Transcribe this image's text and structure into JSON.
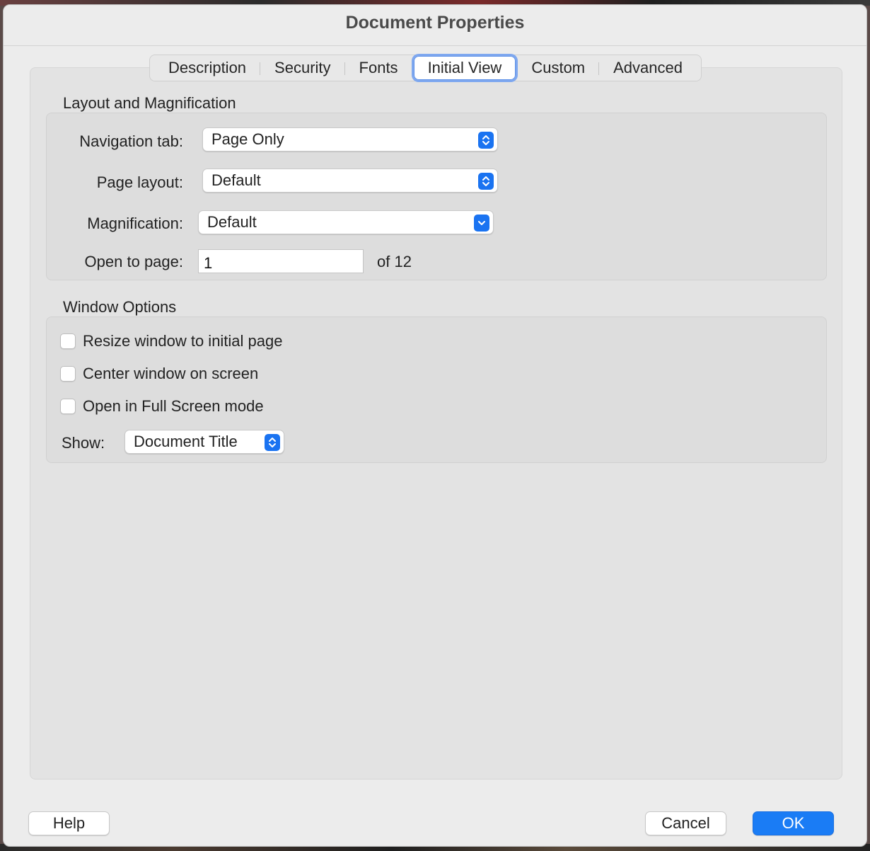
{
  "window": {
    "title": "Document Properties"
  },
  "tabs": [
    {
      "label": "Description"
    },
    {
      "label": "Security"
    },
    {
      "label": "Fonts"
    },
    {
      "label": "Initial View",
      "active": true
    },
    {
      "label": "Custom"
    },
    {
      "label": "Advanced"
    }
  ],
  "layout": {
    "section_label": "Layout and Magnification",
    "navigation_tab": {
      "label": "Navigation tab:",
      "value": "Page Only"
    },
    "page_layout": {
      "label": "Page layout:",
      "value": "Default"
    },
    "magnification": {
      "label": "Magnification:",
      "value": "Default"
    },
    "open_to_page": {
      "label": "Open to page:",
      "value": "1",
      "suffix": "of 12"
    }
  },
  "window_options": {
    "section_label": "Window Options",
    "resize": {
      "label": "Resize window to initial page",
      "checked": false
    },
    "center": {
      "label": "Center window on screen",
      "checked": false
    },
    "fullscreen": {
      "label": "Open in Full Screen mode",
      "checked": false
    },
    "show": {
      "label": "Show:",
      "value": "Document Title"
    }
  },
  "buttons": {
    "help": "Help",
    "cancel": "Cancel",
    "ok": "OK"
  },
  "colors": {
    "accent": "#1a7cf5",
    "tab_focus_ring": "#7fa8ef",
    "window_bg": "#ececec",
    "group_bg": "#dddddd"
  },
  "icons": {
    "popup": "up-down-chevron-icon",
    "dropdown": "chevron-down-icon"
  }
}
